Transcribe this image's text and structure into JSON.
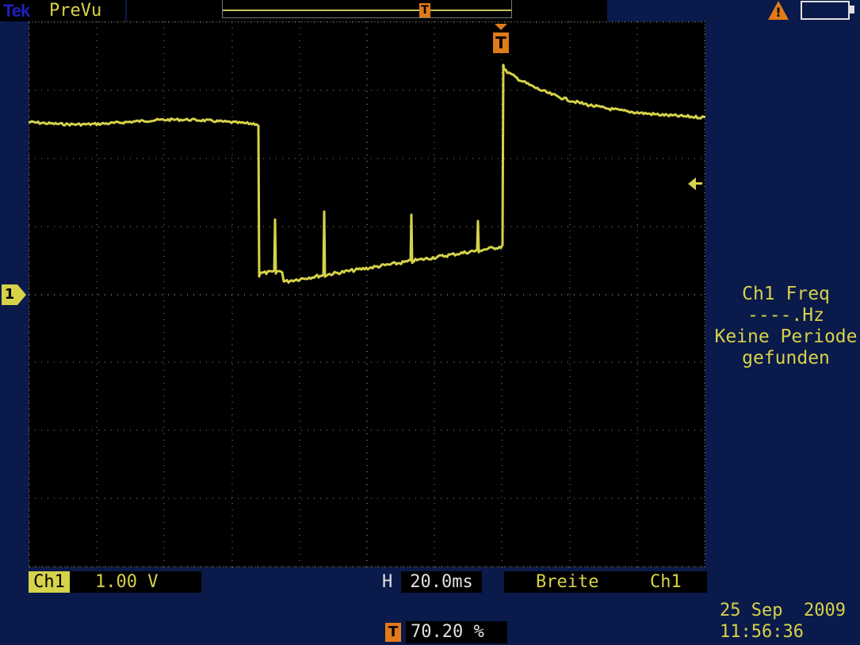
{
  "header": {
    "brand": "Tek",
    "mode": "PreVu"
  },
  "display": {
    "trace_color": "#d6d24a",
    "trigger_color": "#e07a1a",
    "grid_divisions": {
      "horizontal": 10,
      "vertical": 8
    }
  },
  "markers": {
    "channel": "1",
    "trigger": "T"
  },
  "measurement_panel": {
    "line1": "Ch1 Freq",
    "line2": "----.Hz",
    "line3": "Keine Periode",
    "line4": "gefunden"
  },
  "status": {
    "channel": "Ch1",
    "volts_per_div": "1.00 V",
    "horizontal_label": "H",
    "time_per_div": "20.0ms",
    "measurement": "Breite",
    "measurement_source": "Ch1",
    "trigger_level": "70.20 %"
  },
  "datetime": {
    "date": "25 Sep  2009",
    "time": "11:56:36"
  },
  "icons": [
    "warning-icon",
    "battery-icon",
    "trigger-icon"
  ]
}
